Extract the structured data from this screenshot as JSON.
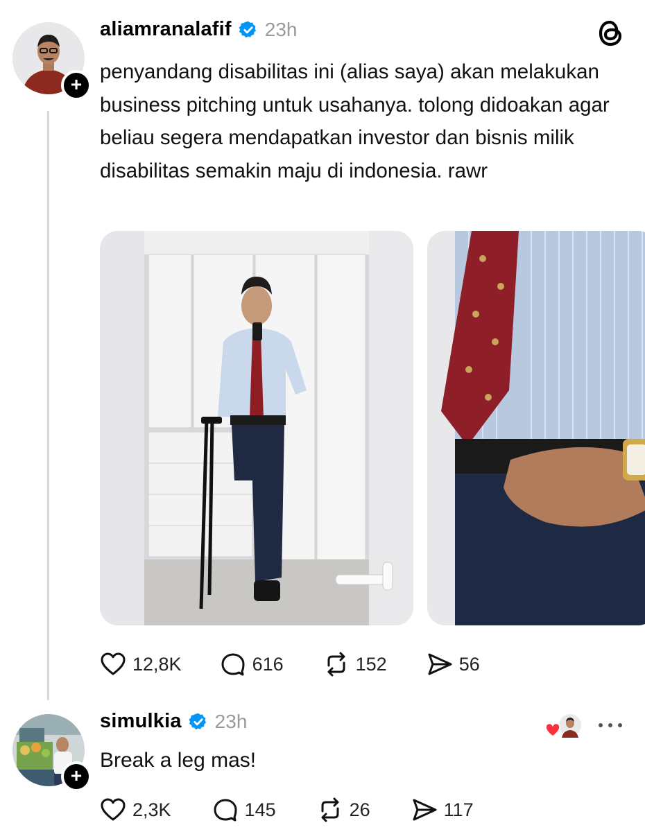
{
  "post": {
    "username": "aliamranalafif",
    "time": "23h",
    "text": "penyandang disabilitas ini (alias saya) akan melakukan business pitching untuk usahanya. tolong didoakan agar beliau segera mendapatkan investor dan bisnis milik disabilitas semakin maju di indonesia. rawr",
    "icons": [
      "verified-badge-icon",
      "threads-logo-icon",
      "follow-plus-icon"
    ],
    "actions": {
      "likes": "12,8K",
      "replies": "616",
      "reposts": "152",
      "shares": "56"
    }
  },
  "reply": {
    "username": "simulkia",
    "time": "23h",
    "text": "Break a leg mas!",
    "icons": [
      "verified-badge-icon",
      "liked-by-author-icon",
      "more-options-icon"
    ],
    "actions": {
      "likes": "2,3K",
      "replies": "145",
      "reposts": "26",
      "shares": "117"
    }
  },
  "colors": {
    "verified": "#0095f6",
    "muted_text": "#9a9a9a",
    "like_heart": "#ff3040",
    "thread_line": "#d9d9d9"
  }
}
